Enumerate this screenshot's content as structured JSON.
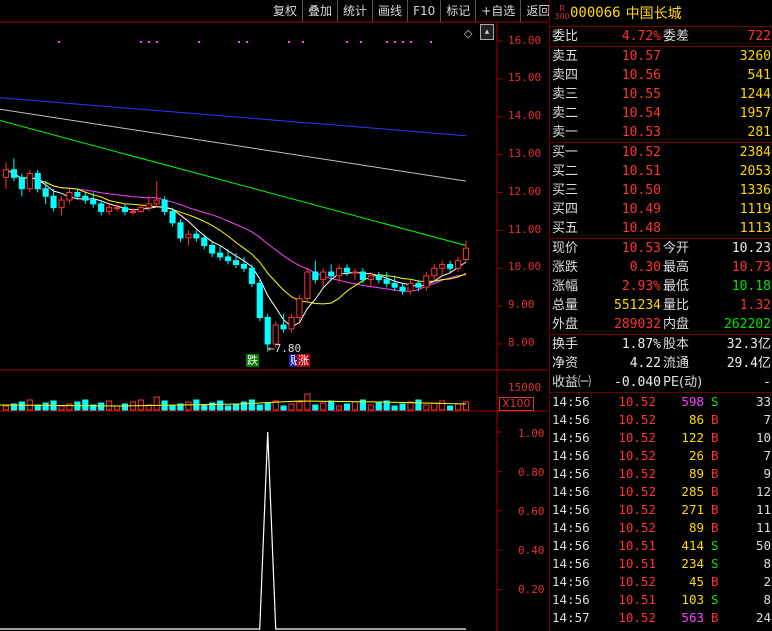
{
  "toolbar": [
    "复权",
    "叠加",
    "统计",
    "画线",
    "F10",
    "标记",
    "+自选",
    "返回"
  ],
  "price_axis": [
    "16.00",
    "15.00",
    "14.00",
    "13.00",
    "12.00",
    "11.00",
    "10.00",
    "9.00",
    "8.00"
  ],
  "volume_axis": {
    "label": "15000",
    "unit": "X100"
  },
  "sub_axis": [
    "1.00",
    "0.80",
    "0.60",
    "0.40",
    "0.20"
  ],
  "annotations": {
    "low": "←7.80",
    "fall": "跌",
    "rise_a": "贴",
    "rise_b": "涨"
  },
  "colors": {
    "up": "#ff3232",
    "down": "#00ffff",
    "ma5": "#ffffff",
    "ma10": "#ffff00",
    "ma20": "#ff40ff",
    "ma60": "#00ff00",
    "ma120": "#c0c0c0",
    "ma250": "#3333ff"
  },
  "chart_data": {
    "type": "candlestick",
    "ylim": [
      7.6,
      16.3
    ],
    "candles": [
      [
        12.4,
        12.8,
        12.1,
        12.6
      ],
      [
        12.6,
        12.9,
        12.3,
        12.4
      ],
      [
        12.4,
        12.5,
        11.9,
        12.1
      ],
      [
        12.1,
        12.6,
        12.0,
        12.5
      ],
      [
        12.5,
        12.6,
        12.0,
        12.1
      ],
      [
        12.1,
        12.3,
        11.7,
        11.9
      ],
      [
        11.9,
        12.1,
        11.5,
        11.6
      ],
      [
        11.6,
        11.9,
        11.4,
        11.8
      ],
      [
        11.8,
        12.1,
        11.7,
        12.0
      ],
      [
        12.0,
        12.1,
        11.8,
        11.9
      ],
      [
        11.9,
        12.0,
        11.7,
        11.8
      ],
      [
        11.8,
        12.0,
        11.6,
        11.7
      ],
      [
        11.7,
        11.8,
        11.4,
        11.5
      ],
      [
        11.5,
        11.7,
        11.4,
        11.6
      ],
      [
        11.6,
        11.7,
        11.5,
        11.6
      ],
      [
        11.6,
        11.7,
        11.4,
        11.5
      ],
      [
        11.5,
        11.6,
        11.4,
        11.5
      ],
      [
        11.5,
        11.7,
        11.5,
        11.6
      ],
      [
        11.6,
        11.9,
        11.5,
        11.7
      ],
      [
        11.7,
        12.3,
        11.6,
        11.8
      ],
      [
        11.8,
        11.9,
        11.4,
        11.5
      ],
      [
        11.5,
        11.6,
        11.1,
        11.2
      ],
      [
        11.2,
        11.3,
        10.7,
        10.8
      ],
      [
        10.8,
        11.0,
        10.6,
        10.9
      ],
      [
        10.9,
        11.0,
        10.7,
        10.8
      ],
      [
        10.8,
        10.9,
        10.5,
        10.6
      ],
      [
        10.6,
        10.7,
        10.3,
        10.4
      ],
      [
        10.4,
        10.6,
        10.2,
        10.3
      ],
      [
        10.3,
        10.5,
        10.1,
        10.2
      ],
      [
        10.2,
        10.4,
        10.0,
        10.1
      ],
      [
        10.1,
        10.3,
        9.9,
        10.0
      ],
      [
        10.0,
        10.1,
        9.5,
        9.6
      ],
      [
        9.6,
        9.7,
        8.6,
        8.7
      ],
      [
        8.7,
        8.8,
        7.8,
        8.0
      ],
      [
        8.0,
        8.6,
        7.9,
        8.5
      ],
      [
        8.5,
        8.8,
        8.3,
        8.4
      ],
      [
        8.4,
        8.8,
        8.3,
        8.7
      ],
      [
        8.7,
        9.3,
        8.6,
        9.2
      ],
      [
        9.2,
        10.0,
        9.1,
        9.9
      ],
      [
        9.9,
        10.2,
        9.6,
        9.7
      ],
      [
        9.7,
        10.0,
        9.5,
        9.9
      ],
      [
        9.9,
        10.1,
        9.7,
        9.8
      ],
      [
        9.8,
        10.1,
        9.6,
        10.0
      ],
      [
        10.0,
        10.1,
        9.8,
        9.9
      ],
      [
        9.9,
        10.0,
        9.7,
        9.9
      ],
      [
        9.9,
        10.0,
        9.6,
        9.7
      ],
      [
        9.7,
        9.9,
        9.5,
        9.8
      ],
      [
        9.8,
        9.9,
        9.6,
        9.7
      ],
      [
        9.7,
        9.9,
        9.5,
        9.6
      ],
      [
        9.6,
        9.8,
        9.4,
        9.5
      ],
      [
        9.5,
        9.6,
        9.3,
        9.4
      ],
      [
        9.4,
        9.7,
        9.3,
        9.6
      ],
      [
        9.6,
        9.7,
        9.4,
        9.5
      ],
      [
        9.5,
        9.9,
        9.4,
        9.8
      ],
      [
        9.8,
        10.1,
        9.7,
        10.0
      ],
      [
        10.0,
        10.2,
        9.8,
        10.1
      ],
      [
        10.1,
        10.2,
        9.9,
        10.0
      ],
      [
        10.0,
        10.3,
        9.9,
        10.2
      ],
      [
        10.23,
        10.73,
        10.18,
        10.53
      ]
    ],
    "ma": {
      "ma250": [
        14.5,
        13.5
      ],
      "ma120": [
        14.2,
        12.3
      ],
      "ma60": [
        13.9,
        10.6
      ],
      "ma20": [
        13.5,
        12.0,
        10.4,
        9.9
      ]
    },
    "volume_max": 15000,
    "signal": {
      "peak_index": 33,
      "value": 1.0
    }
  },
  "quote": {
    "code": "000066",
    "name": "中国长城",
    "badge_top": "R",
    "badge_bottom": "300",
    "weibi": {
      "label": "委比",
      "value": "4.72%",
      "label2": "委差",
      "value2": "722"
    },
    "asks": [
      {
        "label": "卖五",
        "price": "10.57",
        "vol": "3260"
      },
      {
        "label": "卖四",
        "price": "10.56",
        "vol": "541"
      },
      {
        "label": "卖三",
        "price": "10.55",
        "vol": "1244"
      },
      {
        "label": "卖二",
        "price": "10.54",
        "vol": "1957"
      },
      {
        "label": "卖一",
        "price": "10.53",
        "vol": "281"
      }
    ],
    "bids": [
      {
        "label": "买一",
        "price": "10.52",
        "vol": "2384"
      },
      {
        "label": "买二",
        "price": "10.51",
        "vol": "2053"
      },
      {
        "label": "买三",
        "price": "10.50",
        "vol": "1336"
      },
      {
        "label": "买四",
        "price": "10.49",
        "vol": "1119"
      },
      {
        "label": "买五",
        "price": "10.48",
        "vol": "1113"
      }
    ],
    "stats": [
      {
        "l1": "现价",
        "v1": "10.53",
        "c1": "red",
        "l2": "今开",
        "v2": "10.23",
        "c2": "white"
      },
      {
        "l1": "涨跌",
        "v1": "0.30",
        "c1": "red",
        "l2": "最高",
        "v2": "10.73",
        "c2": "red"
      },
      {
        "l1": "涨幅",
        "v1": "2.93%",
        "c1": "red",
        "l2": "最低",
        "v2": "10.18",
        "c2": "green"
      },
      {
        "l1": "总量",
        "v1": "551234",
        "c1": "yellow",
        "l2": "量比",
        "v2": "1.32",
        "c2": "red"
      },
      {
        "l1": "外盘",
        "v1": "289032",
        "c1": "red",
        "l2": "内盘",
        "v2": "262202",
        "c2": "green"
      }
    ],
    "stats2": [
      {
        "l1": "换手",
        "v1": "1.87%",
        "c1": "white",
        "l2": "股本",
        "v2": "32.3亿",
        "c2": "white"
      },
      {
        "l1": "净资",
        "v1": "4.22",
        "c1": "white",
        "l2": "流通",
        "v2": "29.4亿",
        "c2": "white"
      },
      {
        "l1": "收益㈠",
        "v1": "-0.040",
        "c1": "white",
        "l2": "PE(动)",
        "v2": "-",
        "c2": "white"
      }
    ],
    "ticks": [
      {
        "time": "14:56",
        "price": "10.52",
        "vol": "598",
        "vc": "magenta",
        "side": "S",
        "n": "33"
      },
      {
        "time": "14:56",
        "price": "10.52",
        "vol": "86",
        "vc": "yellow",
        "side": "B",
        "n": "7"
      },
      {
        "time": "14:56",
        "price": "10.52",
        "vol": "122",
        "vc": "yellow",
        "side": "B",
        "n": "10"
      },
      {
        "time": "14:56",
        "price": "10.52",
        "vol": "26",
        "vc": "yellow",
        "side": "B",
        "n": "7"
      },
      {
        "time": "14:56",
        "price": "10.52",
        "vol": "89",
        "vc": "yellow",
        "side": "B",
        "n": "9"
      },
      {
        "time": "14:56",
        "price": "10.52",
        "vol": "285",
        "vc": "yellow",
        "side": "B",
        "n": "12"
      },
      {
        "time": "14:56",
        "price": "10.52",
        "vol": "271",
        "vc": "yellow",
        "side": "B",
        "n": "11"
      },
      {
        "time": "14:56",
        "price": "10.52",
        "vol": "89",
        "vc": "yellow",
        "side": "B",
        "n": "11"
      },
      {
        "time": "14:56",
        "price": "10.51",
        "vol": "414",
        "vc": "yellow",
        "side": "S",
        "n": "50"
      },
      {
        "time": "14:56",
        "price": "10.51",
        "vol": "234",
        "vc": "yellow",
        "side": "S",
        "n": "8"
      },
      {
        "time": "14:56",
        "price": "10.52",
        "vol": "45",
        "vc": "yellow",
        "side": "B",
        "n": "2"
      },
      {
        "time": "14:56",
        "price": "10.51",
        "vol": "103",
        "vc": "yellow",
        "side": "S",
        "n": "8"
      },
      {
        "time": "14:57",
        "price": "10.52",
        "vol": "563",
        "vc": "magenta",
        "side": "B",
        "n": "24"
      }
    ]
  }
}
